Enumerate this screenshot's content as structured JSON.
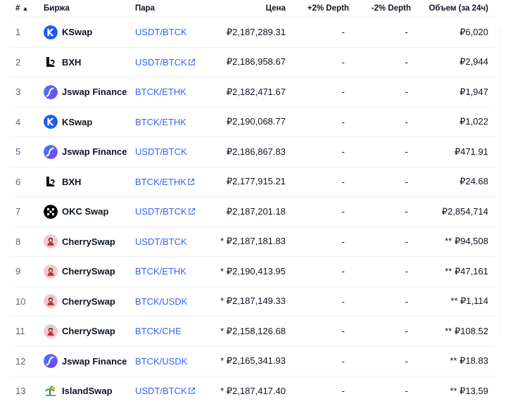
{
  "header": {
    "rank": "#",
    "exchange": "Биржа",
    "pair": "Пара",
    "price": "Цена",
    "plus_depth": "+2% Depth",
    "minus_depth": "-2% Depth",
    "volume": "Объем (за 24ч)"
  },
  "colors": {
    "link": "#3861fb",
    "kswap": "#1a5cf0",
    "jswap_a": "#3e7bfa",
    "jswap_b": "#7b3ff2",
    "bxh": "#111111",
    "okc": "#000000",
    "cherry": "#f2c9cc",
    "island": "#f4b400"
  },
  "rows": [
    {
      "rank": "1",
      "exchange": "KSwap",
      "logo": "kswap-logo-icon",
      "pair": "USDT/BTCK",
      "external": false,
      "price": "₽2,187,289.31",
      "plus": "-",
      "minus": "-",
      "volume": "₽6,020"
    },
    {
      "rank": "2",
      "exchange": "BXH",
      "logo": "bxh-logo-icon",
      "pair": "USDT/BTCK",
      "external": true,
      "price": "₽2,186,958.67",
      "plus": "-",
      "minus": "-",
      "volume": "₽2,944"
    },
    {
      "rank": "3",
      "exchange": "Jswap Finance",
      "logo": "jswap-logo-icon",
      "pair": "BTCK/ETHK",
      "external": false,
      "price": "₽2,182,471.67",
      "plus": "-",
      "minus": "-",
      "volume": "₽1,947"
    },
    {
      "rank": "4",
      "exchange": "KSwap",
      "logo": "kswap-logo-icon",
      "pair": "BTCK/ETHK",
      "external": false,
      "price": "₽2,190,068.77",
      "plus": "-",
      "minus": "-",
      "volume": "₽1,022"
    },
    {
      "rank": "5",
      "exchange": "Jswap Finance",
      "logo": "jswap-logo-icon",
      "pair": "USDT/BTCK",
      "external": false,
      "price": "₽2,186,867.83",
      "plus": "-",
      "minus": "-",
      "volume": "₽471.91"
    },
    {
      "rank": "6",
      "exchange": "BXH",
      "logo": "bxh-logo-icon",
      "pair": "BTCK/ETHK",
      "external": true,
      "price": "₽2,177,915.21",
      "plus": "-",
      "minus": "-",
      "volume": "₽24.68"
    },
    {
      "rank": "7",
      "exchange": "OKC Swap",
      "logo": "okc-logo-icon",
      "pair": "USDT/BTCK",
      "external": true,
      "price": "₽2,187,201.18",
      "plus": "-",
      "minus": "-",
      "volume": "₽2,854,714"
    },
    {
      "rank": "8",
      "exchange": "CherrySwap",
      "logo": "cherry-logo-icon",
      "pair": "USDT/BTCK",
      "external": false,
      "price": "* ₽2,187,181.83",
      "plus": "-",
      "minus": "-",
      "volume": "** ₽94,508"
    },
    {
      "rank": "9",
      "exchange": "CherrySwap",
      "logo": "cherry-logo-icon",
      "pair": "BTCK/ETHK",
      "external": false,
      "price": "* ₽2,190,413.95",
      "plus": "-",
      "minus": "-",
      "volume": "** ₽47,161"
    },
    {
      "rank": "10",
      "exchange": "CherrySwap",
      "logo": "cherry-logo-icon",
      "pair": "BTCK/USDK",
      "external": false,
      "price": "* ₽2,187,149.33",
      "plus": "-",
      "minus": "-",
      "volume": "** ₽1,114"
    },
    {
      "rank": "11",
      "exchange": "CherrySwap",
      "logo": "cherry-logo-icon",
      "pair": "BTCK/CHE",
      "external": false,
      "price": "* ₽2,158,126.68",
      "plus": "-",
      "minus": "-",
      "volume": "** ₽108.52"
    },
    {
      "rank": "12",
      "exchange": "Jswap Finance",
      "logo": "jswap-logo-icon",
      "pair": "BTCK/USDK",
      "external": false,
      "price": "* ₽2,165,341.93",
      "plus": "-",
      "minus": "-",
      "volume": "** ₽18.83"
    },
    {
      "rank": "13",
      "exchange": "IslandSwap",
      "logo": "island-logo-icon",
      "pair": "USDT/BTCK",
      "external": true,
      "price": "* ₽2,187,417.40",
      "plus": "-",
      "minus": "-",
      "volume": "** ₽13.59"
    }
  ]
}
